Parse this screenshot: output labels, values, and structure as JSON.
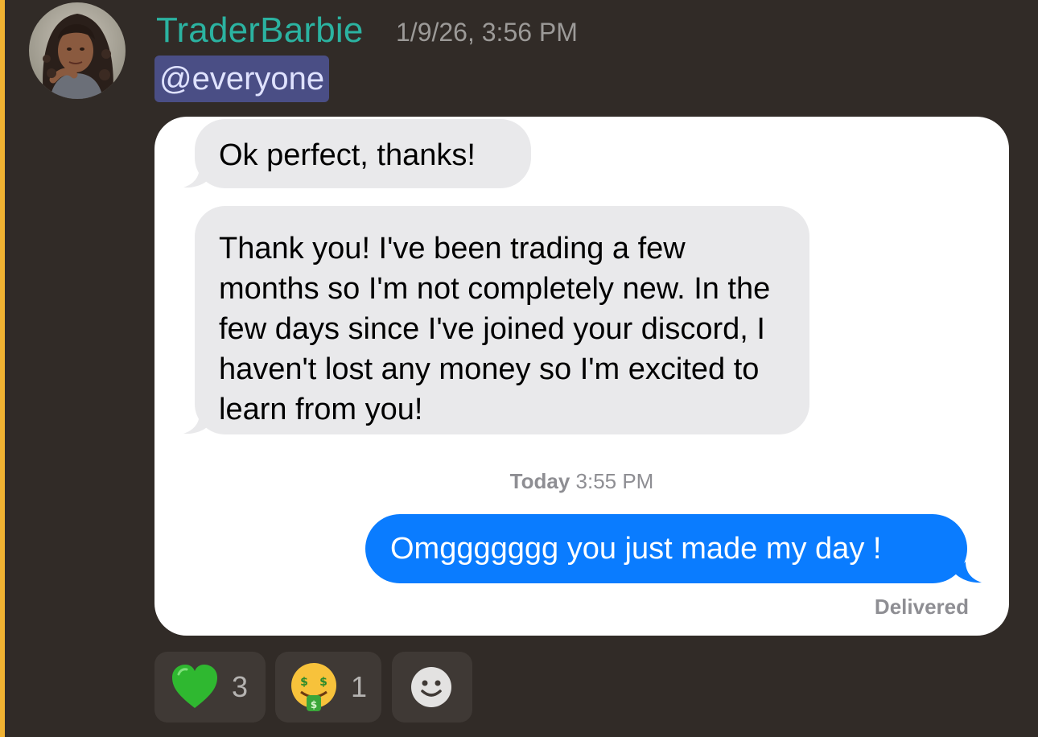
{
  "colors": {
    "background": "#312b27",
    "mention_bar": "#f0b232",
    "username": "#2bb3a1",
    "mention_bg": "#4a4e85",
    "received_bubble": "#e9e9eb",
    "sent_bubble": "#0a7cff"
  },
  "message": {
    "author": "TraderBarbie",
    "timestamp": "1/9/26, 3:56 PM",
    "mention": "@everyone",
    "avatar_icon": "user-avatar-photo"
  },
  "screenshot": {
    "received_1": "Ok perfect, thanks!",
    "received_2": "Thank you! I've been trading a few months so I'm not completely new. In the few days since I've joined your discord, I haven't lost any money so I'm excited to learn from you!",
    "time_day": "Today",
    "time_clock": "3:55 PM",
    "sent_1": "Omggggggg you just made my day !",
    "status": "Delivered"
  },
  "reactions": [
    {
      "emoji": "green-heart-icon",
      "count": "3"
    },
    {
      "emoji": "money-mouth-face-icon",
      "count": "1"
    },
    {
      "emoji": "add-reaction-icon",
      "count": ""
    }
  ]
}
